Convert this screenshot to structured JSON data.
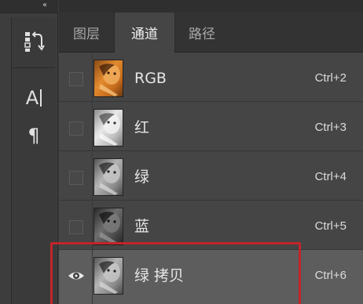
{
  "toolbar": {
    "collapse_glyph": "‹‹",
    "tools": [
      {
        "name": "history-icon"
      },
      {
        "name": "character-icon",
        "glyph": "A"
      },
      {
        "name": "paragraph-icon",
        "glyph": "¶"
      }
    ]
  },
  "tabs": [
    {
      "label": "图层",
      "active": false
    },
    {
      "label": "通道",
      "active": true
    },
    {
      "label": "路径",
      "active": false
    }
  ],
  "channels": [
    {
      "label": "RGB",
      "shortcut": "Ctrl+2",
      "visible": false,
      "thumb": "color"
    },
    {
      "label": "红",
      "shortcut": "Ctrl+3",
      "visible": false,
      "thumb": "light"
    },
    {
      "label": "绿",
      "shortcut": "Ctrl+4",
      "visible": false,
      "thumb": "mid"
    },
    {
      "label": "蓝",
      "shortcut": "Ctrl+5",
      "visible": false,
      "thumb": "dark"
    },
    {
      "label": "绿 拷贝",
      "shortcut": "Ctrl+6",
      "visible": true,
      "thumb": "mid",
      "selected": true
    }
  ],
  "colors": {
    "highlight_border": "#c1252a",
    "panel_bg": "#454545",
    "selected_row": "#5d5d5d"
  }
}
